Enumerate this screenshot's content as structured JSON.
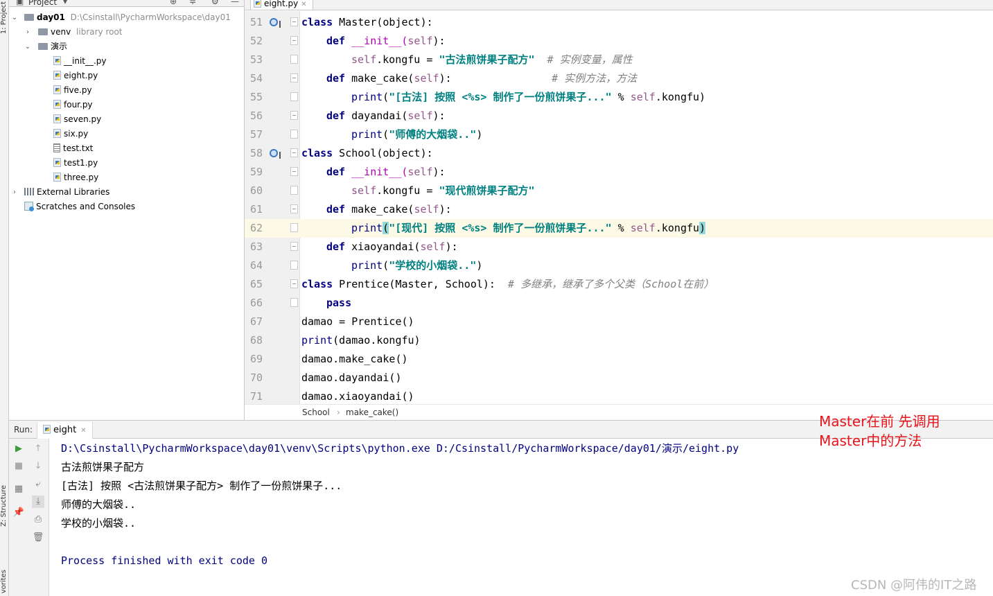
{
  "left_strip": {
    "project_tab": "1: Project",
    "structure_tab": "Z: Structure",
    "favorites_tab": "vorites"
  },
  "project_panel": {
    "title": "Project",
    "root": {
      "name": "day01",
      "path": "D:\\Csinstall\\PycharmWorkspace\\day01"
    },
    "venv": {
      "name": "venv",
      "note": "library root"
    },
    "folder": "演示",
    "files": [
      "__init__.py",
      "eight.py",
      "five.py",
      "four.py",
      "seven.py",
      "six.py",
      "test.txt",
      "test1.py",
      "three.py"
    ],
    "external_libraries": "External Libraries",
    "scratches": "Scratches and Consoles"
  },
  "editor": {
    "tab": "eight.py",
    "line_numbers": [
      "51",
      "52",
      "53",
      "54",
      "55",
      "56",
      "57",
      "58",
      "59",
      "60",
      "61",
      "62",
      "63",
      "64",
      "65",
      "66",
      "67",
      "68",
      "69",
      "70",
      "71"
    ],
    "code": {
      "l51": {
        "kw": "class",
        "rest": " Master(object):"
      },
      "l52": {
        "kw": "def",
        "name": " __init__(",
        "slf": "self",
        "end": "):"
      },
      "l53": {
        "slf": "self",
        "mid": ".kongfu = ",
        "str": "\"古法煎饼果子配方\"",
        "cmt": "  # 实例变量，属性"
      },
      "l54": {
        "kw": "def",
        "name": " make_cake(",
        "slf": "self",
        "end": "):",
        "cmt": "                # 实例方法，方法"
      },
      "l55": {
        "fn": "print",
        "open": "(",
        "str": "\"[古法] 按照 <%s> 制作了一份煎饼果子...\"",
        "mid": " % ",
        "slf": "self",
        "end": ".kongfu)"
      },
      "l56": {
        "kw": "def",
        "name": " dayandai(",
        "slf": "self",
        "end": "):"
      },
      "l57": {
        "fn": "print",
        "open": "(",
        "str": "\"师傅的大烟袋..\"",
        "end": ")"
      },
      "l58": {
        "kw": "class",
        "rest": " School(object):"
      },
      "l59": {
        "kw": "def",
        "name": " __init__(",
        "slf": "self",
        "end": "):"
      },
      "l60": {
        "slf": "self",
        "mid": ".kongfu = ",
        "str": "\"现代煎饼果子配方\""
      },
      "l61": {
        "kw": "def",
        "name": " make_cake(",
        "slf": "self",
        "end": "):"
      },
      "l62": {
        "fn": "print",
        "open": "(",
        "str": "\"[现代] 按照 <%s> 制作了一份煎饼果子...\"",
        "mid": " % ",
        "slf": "self",
        "end": ".kongfu",
        "close": ")"
      },
      "l63": {
        "kw": "def",
        "name": " xiaoyandai(",
        "slf": "self",
        "end": "):"
      },
      "l64": {
        "fn": "print",
        "open": "(",
        "str": "\"学校的小烟袋..\"",
        "end": ")"
      },
      "l65": {
        "kw": "class",
        "rest": " Prentice(Master, School):",
        "cmt": "  # 多继承，继承了多个父类（School在前）"
      },
      "l66": {
        "kw": "pass"
      },
      "l67": {
        "text": "damao = Prentice()"
      },
      "l68": {
        "fn": "print",
        "rest": "(damao.kongfu)"
      },
      "l69": {
        "text": "damao.make_cake()"
      },
      "l70": {
        "text": "damao.dayandai()"
      },
      "l71": {
        "text": "damao.xiaoyandai()"
      }
    },
    "breadcrumb": [
      "School",
      "make_cake()"
    ]
  },
  "run_panel": {
    "label": "Run:",
    "tab": "eight",
    "console": [
      "D:\\Csinstall\\PycharmWorkspace\\day01\\venv\\Scripts\\python.exe D:/Csinstall/PycharmWorkspace/day01/演示/eight.py",
      "古法煎饼果子配方",
      "[古法] 按照 <古法煎饼果子配方> 制作了一份煎饼果子...",
      "师傅的大烟袋..",
      "学校的小烟袋..",
      "",
      "Process finished with exit code 0"
    ]
  },
  "annotation": {
    "line1": "Master在前 先调用",
    "line2": "Master中的方法"
  },
  "watermark": "CSDN @阿伟的IT之路",
  "colors": {
    "keyword": "#000080",
    "string": "#008080",
    "comment": "#808080",
    "self": "#94558d",
    "annotation": "#e8141a"
  }
}
